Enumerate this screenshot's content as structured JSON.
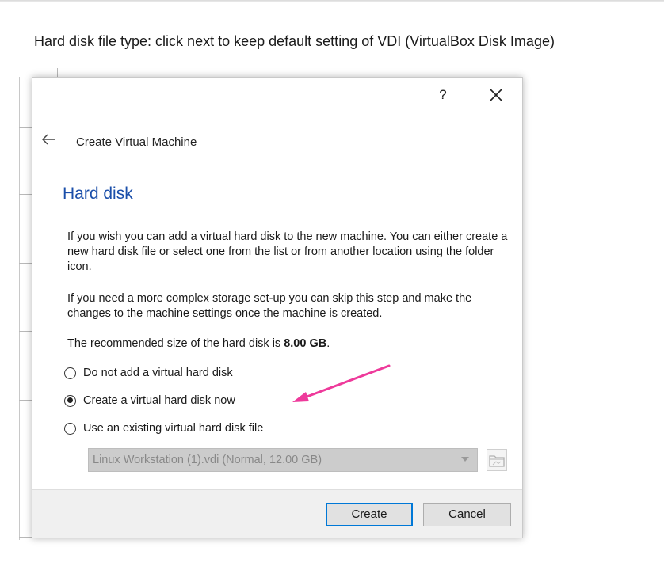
{
  "caption": "Hard disk file type:  click next to keep default setting of VDI (VirtualBox Disk Image)",
  "dialog": {
    "help_label": "?",
    "title": "Create Virtual Machine",
    "section_title": "Hard disk",
    "paragraph1": "If you wish you can add a virtual hard disk to the new machine. You can either create a new hard disk file or select one from the list or from another location using the folder icon.",
    "paragraph2": "If you need a more complex storage set-up you can skip this step and make the changes to the machine settings once the machine is created.",
    "recommended_prefix": "The recommended size of the hard disk is ",
    "recommended_size": "8.00 GB",
    "recommended_suffix": ".",
    "options": [
      {
        "label": "Do not add a virtual hard disk",
        "selected": false
      },
      {
        "label": "Create a virtual hard disk now",
        "selected": true
      },
      {
        "label": "Use an existing virtual hard disk file",
        "selected": false
      }
    ],
    "existing_disk_value": "Linux Workstation (1).vdi (Normal, 12.00 GB)",
    "create_label": "Create",
    "cancel_label": "Cancel"
  },
  "colors": {
    "section_title": "#1b4faa",
    "arrow": "#ee3a9b",
    "default_button_border": "#0078d7"
  },
  "icons": {
    "back": "arrow-left-icon",
    "close": "close-icon",
    "folder": "folder-icon",
    "dropdown": "chevron-down-icon"
  }
}
